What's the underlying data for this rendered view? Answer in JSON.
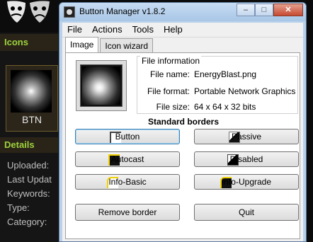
{
  "background": {
    "sidebar_heading": "Icons",
    "button_tag": "BTN",
    "details_heading": "Details",
    "fields": [
      "Uploaded:",
      "Last Updat",
      "Keywords:",
      "Type:",
      "Category:"
    ]
  },
  "window": {
    "title": "Button Manager v1.8.2",
    "controls": [
      "–",
      "□",
      "✕"
    ]
  },
  "menu": [
    "File",
    "Actions",
    "Tools",
    "Help"
  ],
  "tabs": [
    {
      "label": "Image",
      "active": true
    },
    {
      "label": "Icon wizard",
      "active": false
    }
  ],
  "file_info": {
    "legend": "File information",
    "rows": [
      {
        "key": "File name:",
        "value": "EnergyBlast.png"
      },
      {
        "key": "File format:",
        "value": "Portable Network Graphics"
      },
      {
        "key": "File size:",
        "value": "64 x 64 x 32 bits"
      }
    ]
  },
  "standard_borders": {
    "title": "Standard borders",
    "buttons": [
      {
        "label": "Button",
        "icon": "button-border-icon"
      },
      {
        "label": "Passive",
        "icon": "passive-border-icon"
      },
      {
        "label": "Autocast",
        "icon": "autocast-border-icon"
      },
      {
        "label": "Disabled",
        "icon": "disabled-border-icon"
      },
      {
        "label": "Info-Basic",
        "icon": "info-basic-border-icon"
      },
      {
        "label": "Info-Upgrade",
        "icon": "info-upgrade-border-icon"
      }
    ]
  },
  "actions": {
    "remove_border": "Remove border",
    "quit": "Quit"
  }
}
